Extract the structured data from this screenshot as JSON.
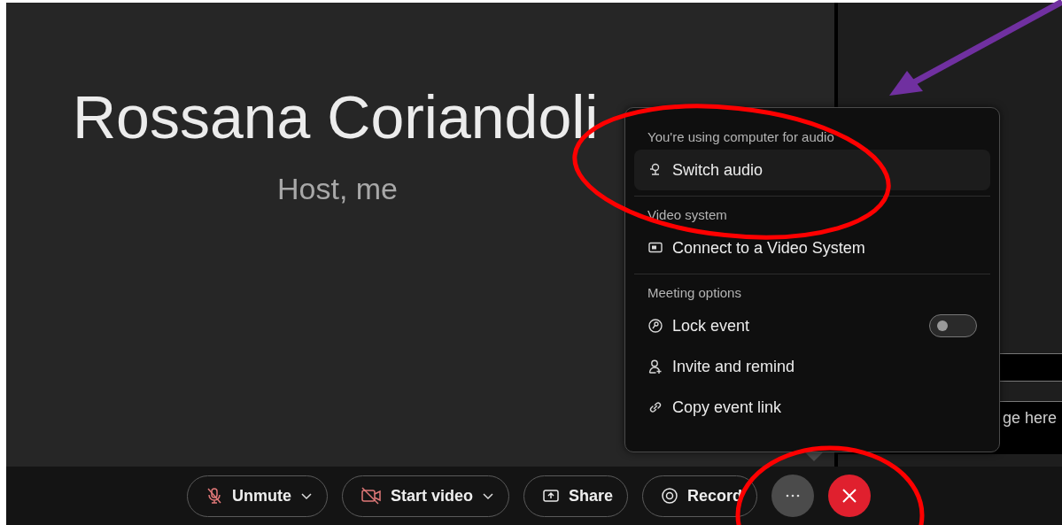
{
  "speaker": {
    "name": "Rossana Coriandoli",
    "role": "Host, me"
  },
  "chat": {
    "placeholder": "ge here"
  },
  "menu": {
    "sections": [
      {
        "heading": "You're using computer for audio",
        "items": [
          {
            "label": "Switch audio",
            "kind": "action",
            "highlighted": true
          }
        ]
      },
      {
        "heading": "Video system",
        "items": [
          {
            "label": "Connect to a Video System",
            "kind": "action",
            "highlighted": false
          }
        ]
      },
      {
        "heading": "Meeting options",
        "items": [
          {
            "label": "Lock event",
            "kind": "toggle",
            "on": false,
            "highlighted": false
          },
          {
            "label": "Invite and remind",
            "kind": "action",
            "highlighted": false
          },
          {
            "label": "Copy event link",
            "kind": "action",
            "highlighted": false
          }
        ]
      }
    ]
  },
  "toolbar": [
    {
      "label": "Unmute",
      "kind": "dropdown",
      "off": true
    },
    {
      "label": "Start video",
      "kind": "dropdown",
      "off": true
    },
    {
      "label": "Share",
      "kind": "plain",
      "off": false
    },
    {
      "label": "Record",
      "kind": "plain",
      "off": false
    },
    {
      "kind": "more"
    },
    {
      "kind": "end"
    }
  ],
  "annotations": [
    {
      "kind": "ellipse"
    },
    {
      "kind": "ellipse"
    },
    {
      "kind": "arrow"
    }
  ]
}
